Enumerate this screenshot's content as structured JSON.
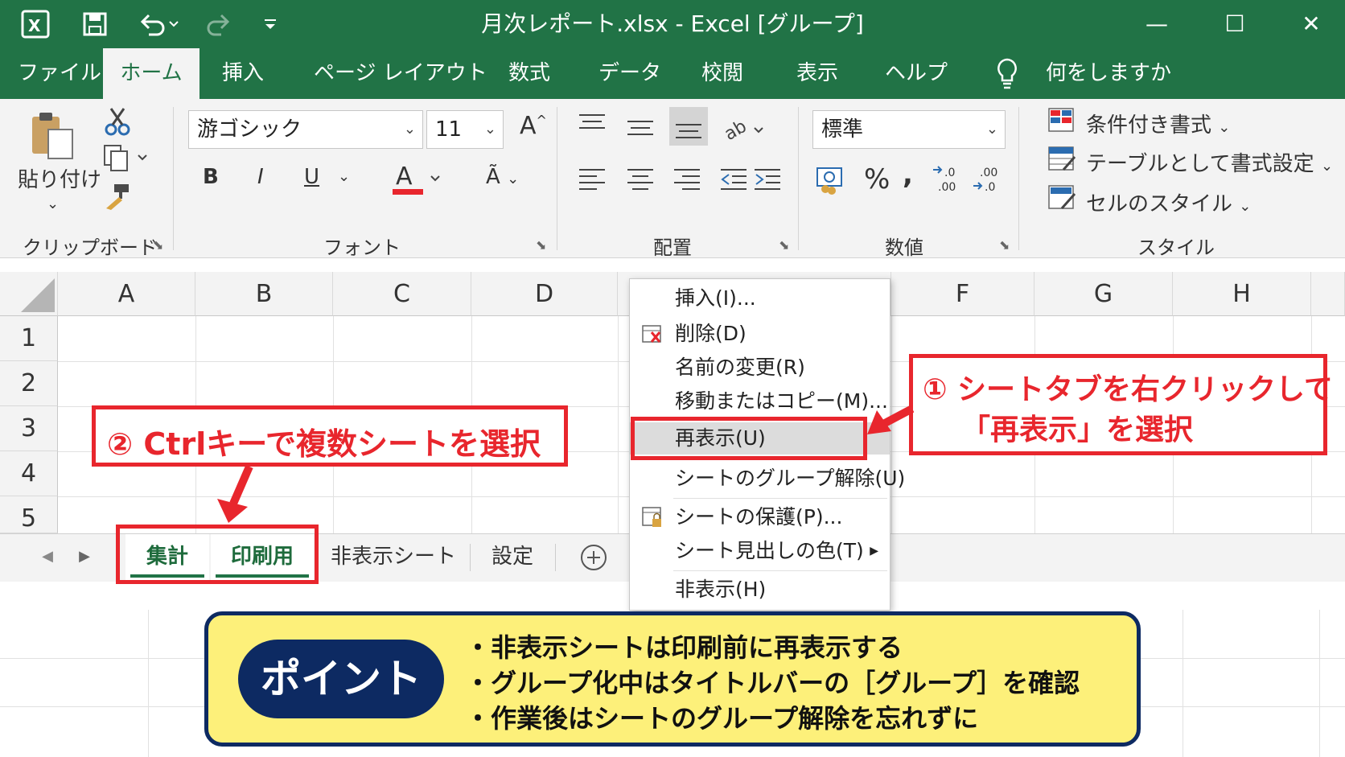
{
  "titlebar": {
    "title": "月次レポート.xlsx  -  Excel [グループ]",
    "excel_icon": "excel-logo-icon",
    "save_icon": "save-icon",
    "undo_icon": "undo-icon",
    "redo_icon": "redo-icon",
    "customize_icon": "customize-quick-access-icon",
    "minimize": "—",
    "maximize": "☐",
    "close": "✕"
  },
  "tabs": [
    "ファイル",
    "ホーム",
    "挿入",
    "ページ レイアウト",
    "数式",
    "データ",
    "校閲",
    "表示",
    "ヘルプ"
  ],
  "tell_me": "何をしますか",
  "ribbon": {
    "clipboard": {
      "paste": "貼り付け",
      "label": "クリップボード"
    },
    "font": {
      "name": "游ゴシック",
      "size": "11",
      "bold": "B",
      "italic": "I",
      "underline": "U",
      "label": "フォント"
    },
    "alignment": {
      "label": "配置"
    },
    "number": {
      "format": "標準",
      "percent": "%",
      "comma": ",",
      "label": "数値"
    },
    "styles": {
      "conditional": "条件付き書式",
      "table": "テーブルとして書式設定",
      "cell_styles": "セルのスタイル",
      "label": "スタイル"
    }
  },
  "grid": {
    "columns_left": [
      "A",
      "B",
      "C",
      "D"
    ],
    "columns_right": [
      "F",
      "G",
      "H"
    ],
    "rows": [
      "1",
      "2",
      "3",
      "4",
      "5"
    ]
  },
  "sheets": [
    "集計",
    "印刷用",
    "非表示シート",
    "設定"
  ],
  "sheet_nav": {
    "prev": "◀",
    "next": "▶",
    "add": "+"
  },
  "context_menu": [
    {
      "label": "挿入(I)..."
    },
    {
      "label": "削除(D)"
    },
    {
      "label": "名前の変更(R)"
    },
    {
      "label": "移動またはコピー(M)..."
    },
    {
      "label": "再表示(U)"
    },
    {
      "label": "シートのグループ解除(U)"
    },
    {
      "label": "シートの保護(P)..."
    },
    {
      "label": "シート見出しの色(T)"
    },
    {
      "label": "非表示(H)"
    }
  ],
  "callouts": {
    "step1_line1": "① シートタブを右クリックして",
    "step1_line2": "「再表示」を選択",
    "step2": "② Ctrlキーで複数シートを選択"
  },
  "point": {
    "badge": "ポイント",
    "items": [
      "・非表示シートは印刷前に再表示する",
      "・グループ化中はタイトルバーの［グループ］を確認",
      "・作業後はシートのグループ解除を忘れずに"
    ]
  },
  "colors": {
    "excel_green": "#217346",
    "callout_red": "#e8262d",
    "point_yellow": "#fdf07a",
    "point_navy": "#0d2a62"
  }
}
